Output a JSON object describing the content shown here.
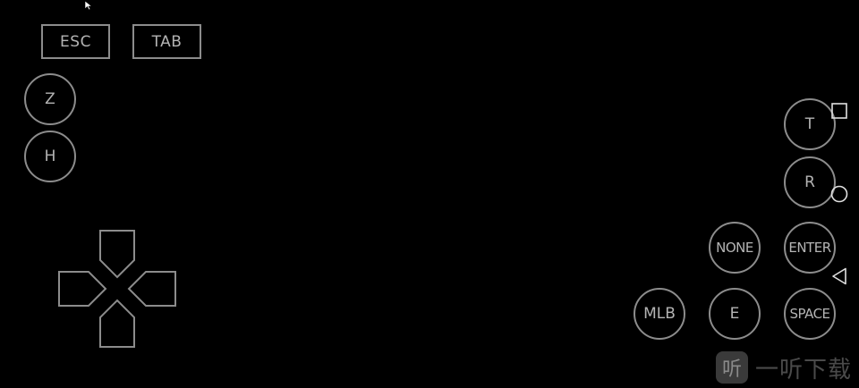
{
  "keys": {
    "esc": "ESC",
    "tab": "TAB",
    "z": "Z",
    "h": "H",
    "t": "T",
    "r": "R",
    "none": "NONE",
    "enter": "ENTER",
    "mlb": "MLB",
    "e": "E",
    "space": "SPACE"
  },
  "watermark": {
    "badge": "听",
    "text": "一听下载"
  },
  "icons": {
    "pointer": "mouse-pointer-icon",
    "dpad": "dpad-icon",
    "nav_recents": "square-icon",
    "nav_home": "circle-icon",
    "nav_back": "triangle-back-icon"
  }
}
